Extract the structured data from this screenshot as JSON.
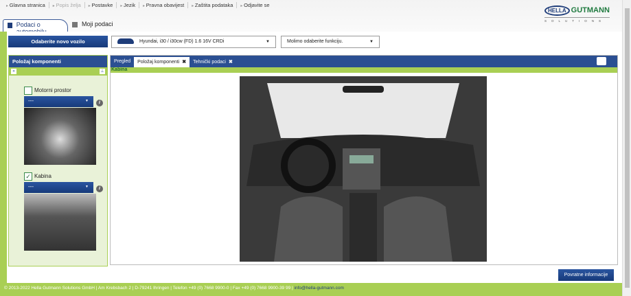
{
  "nav": [
    "Glavna stranica",
    "Popis želja",
    "Postavke",
    "Jezik",
    "Pravna obavijest",
    "Zaštita podataka",
    "Odjavite se"
  ],
  "logo": {
    "hella": "HELLA",
    "gutmann": "GUTMANN",
    "solutions": "SOLUTIONS"
  },
  "tabs": [
    "Podaci o automobilu",
    "Moji podaci"
  ],
  "vehicle": {
    "new_button": "Odaberite novo vozilo",
    "selected": "Hyundai, i30 / i30cw (FD) 1.6 16V CRDi",
    "function_placeholder": "Molimo odaberite funkciju."
  },
  "left_panel": {
    "title": "Položaj komponenti",
    "components": [
      {
        "label": "Motorni prostor",
        "checked": false,
        "dropdown": "---"
      },
      {
        "label": "Kabina",
        "checked": true,
        "dropdown": "---"
      }
    ]
  },
  "right_panel": {
    "tabs": [
      "Pregled",
      "Položaj komponenti",
      "Tehnički podaci"
    ],
    "active_tab": "Položaj komponenti",
    "section": "Kabina"
  },
  "feedback_button": "Povratne informacije",
  "footer": {
    "text": "© 2013-2022 Hella Gutmann Solutions GmbH | Am Krebsbach 2 | D-79241 Ihringen | Telefon +49 (0) 7668 9900-0 | Fax +49 (0) 7668 9900-39 99 | ",
    "email": "info@hella-gutmann.com"
  },
  "colors": {
    "accent_green": "#a9cf54",
    "brand_blue": "#2b4f92"
  }
}
